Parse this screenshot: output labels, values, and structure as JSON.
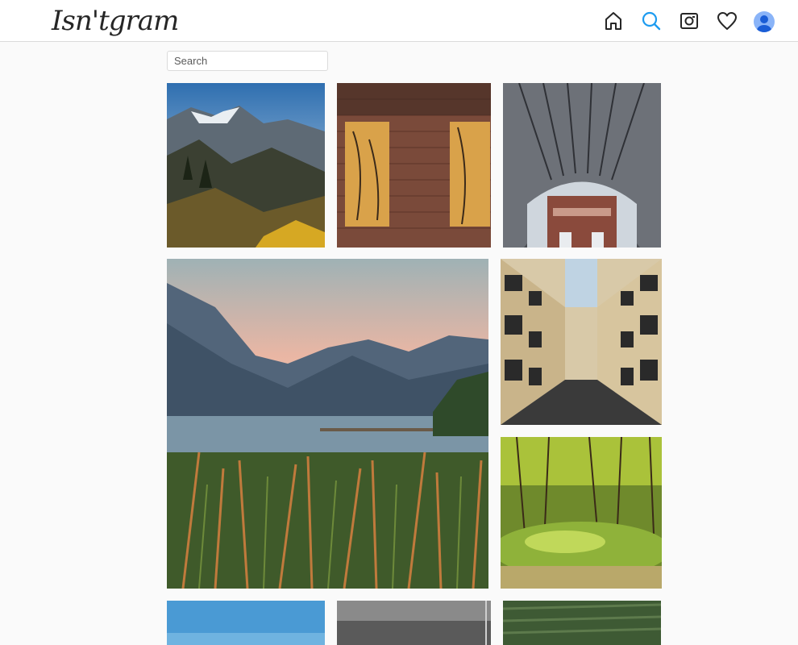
{
  "header": {
    "logo_text": "Isn'tgram",
    "icons": [
      "home-icon",
      "search-icon",
      "camera-icon",
      "heart-icon",
      "avatar"
    ],
    "active_color": "#1d9bf0",
    "icon_color": "#262626"
  },
  "search": {
    "placeholder": "Search",
    "value": ""
  },
  "grid": {
    "photos": [
      {
        "id": "mountain-hikers"
      },
      {
        "id": "brick-windows"
      },
      {
        "id": "station-roof"
      },
      {
        "id": "lake-reeds"
      },
      {
        "id": "city-street-balconies"
      },
      {
        "id": "forest-moss"
      },
      {
        "id": "blue-sky"
      },
      {
        "id": "gray-scene"
      },
      {
        "id": "green-field"
      }
    ]
  }
}
